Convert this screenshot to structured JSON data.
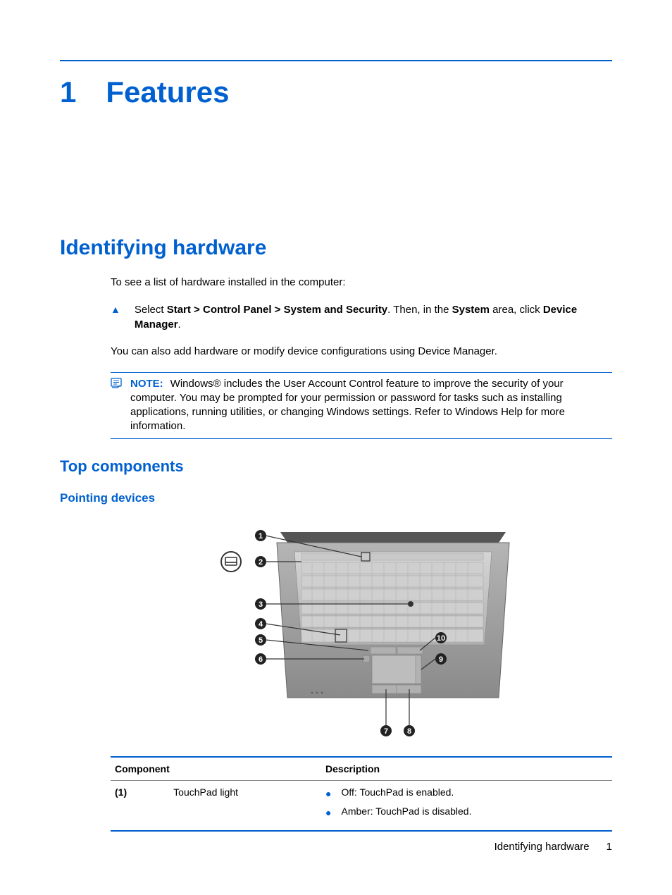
{
  "chapter": {
    "number": "1",
    "title": "Features"
  },
  "section1": {
    "title": "Identifying hardware",
    "intro": "To see a list of hardware installed in the computer:",
    "step_prefix": "Select ",
    "step_bold1": "Start > Control Panel > System and Security",
    "step_mid": ". Then, in the ",
    "step_bold2": "System",
    "step_mid2": " area, click ",
    "step_bold3": "Device Manager",
    "step_end": ".",
    "followup": "You can also add hardware or modify device configurations using Device Manager."
  },
  "note": {
    "label": "NOTE:",
    "text": "Windows® includes the User Account Control feature to improve the security of your computer. You may be prompted for your permission or password for tasks such as installing applications, running utilities, or changing Windows settings. Refer to Windows Help for more information."
  },
  "section2": {
    "title": "Top components"
  },
  "section3": {
    "title": "Pointing devices"
  },
  "diagram": {
    "callouts": [
      "1",
      "2",
      "3",
      "4",
      "5",
      "6",
      "7",
      "8",
      "9",
      "10"
    ]
  },
  "table": {
    "headers": {
      "component": "Component",
      "description": "Description"
    },
    "rows": [
      {
        "idx": "(1)",
        "component": "TouchPad light",
        "descriptions": [
          "Off: TouchPad is enabled.",
          "Amber: TouchPad is disabled."
        ]
      }
    ]
  },
  "footer": {
    "section": "Identifying hardware",
    "page": "1"
  }
}
